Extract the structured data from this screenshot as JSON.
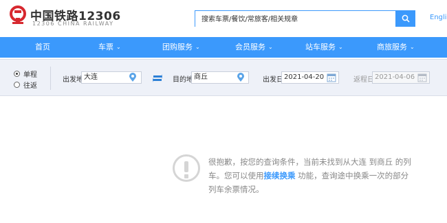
{
  "header": {
    "brand_cn": "中国铁路12306",
    "brand_en": "12306 CHINA RAILWAY",
    "search_placeholder": "搜索车票/餐饮/常旅客/相关规章",
    "lang_link": "English",
    "colors": {
      "accent": "#3b99fc",
      "logo_red": "#d7282f"
    }
  },
  "nav": {
    "items": [
      {
        "label": "首页",
        "has_dropdown": false
      },
      {
        "label": "车票",
        "has_dropdown": true
      },
      {
        "label": "团购服务",
        "has_dropdown": true
      },
      {
        "label": "会员服务",
        "has_dropdown": true
      },
      {
        "label": "站车服务",
        "has_dropdown": true
      },
      {
        "label": "商旅服务",
        "has_dropdown": true
      }
    ]
  },
  "query": {
    "trip_types": [
      {
        "label": "单程",
        "checked": true
      },
      {
        "label": "往返",
        "checked": false
      }
    ],
    "from_label": "出发地",
    "from_value": "大连",
    "to_label": "目的地",
    "to_value": "商丘",
    "depart_label": "出发日",
    "depart_value": "2021-04-20",
    "return_label": "返程日",
    "return_value": "2021-04-06"
  },
  "message": {
    "part1": "很抱歉，按您的查询条件，当前未找到从大连 到商丘 的列车。您可以使用",
    "link": "接续换乘",
    "part2": " 功能，查询途中换乘一次的部分列车余票情况。"
  }
}
